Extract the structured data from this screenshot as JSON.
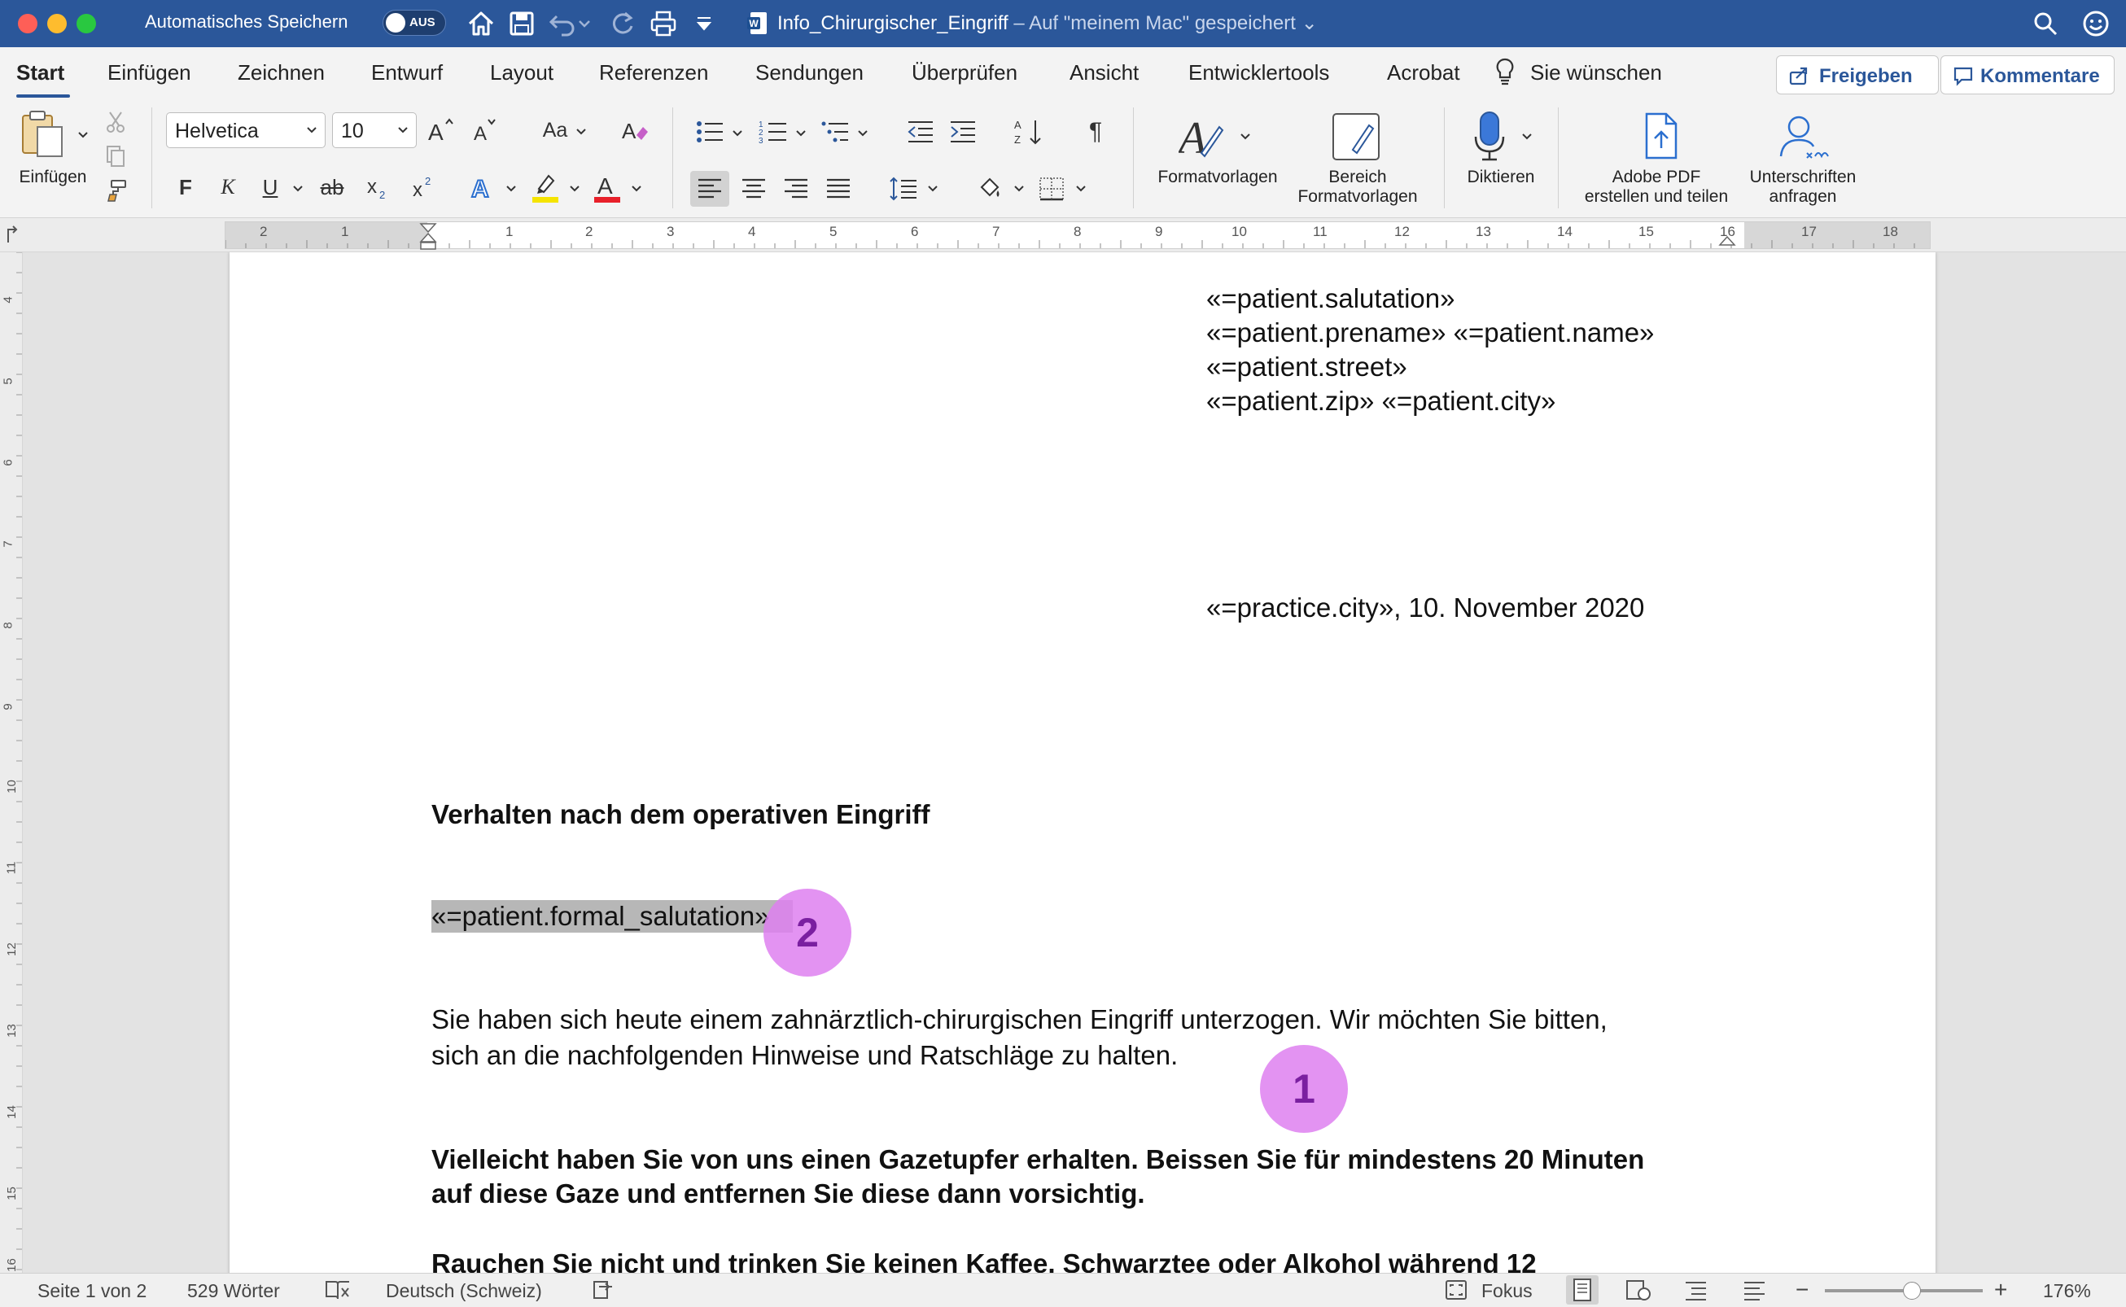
{
  "titlebar": {
    "autosave_label": "Automatisches Speichern",
    "autosave_state": "AUS",
    "doc_title": "Info_Chirurgischer_Eingriff",
    "doc_location": "– Auf \"meinem Mac\" gespeichert"
  },
  "tabs": [
    {
      "label": "Start",
      "active": true
    },
    {
      "label": "Einfügen"
    },
    {
      "label": "Zeichnen"
    },
    {
      "label": "Entwurf"
    },
    {
      "label": "Layout"
    },
    {
      "label": "Referenzen"
    },
    {
      "label": "Sendungen"
    },
    {
      "label": "Überprüfen"
    },
    {
      "label": "Ansicht"
    },
    {
      "label": "Entwicklertools"
    },
    {
      "label": "Acrobat"
    },
    {
      "label": "Sie wünschen"
    }
  ],
  "ribbon_actions": {
    "share": "Freigeben",
    "comments": "Kommentare"
  },
  "ribbon": {
    "paste_label": "Einfügen",
    "font_name": "Helvetica",
    "font_size": "10",
    "bold": "F",
    "italic": "K",
    "underline": "U",
    "strike": "ab",
    "change_case": "Aa",
    "styles_label": "Formatvorlagen",
    "styles_pane_line1": "Bereich",
    "styles_pane_line2": "Formatvorlagen",
    "dictate_label": "Diktieren",
    "adobe_line1": "Adobe PDF",
    "adobe_line2": "erstellen und teilen",
    "sign_line1": "Unterschriften",
    "sign_line2": "anfragen"
  },
  "ruler": {
    "numbers": [
      "2",
      "1",
      "1",
      "2",
      "3",
      "4",
      "5",
      "6",
      "7",
      "8",
      "9",
      "10",
      "11",
      "12",
      "13",
      "14",
      "15",
      "16",
      "17",
      "18"
    ],
    "vertical_numbers": [
      "4",
      "5",
      "6",
      "7",
      "8",
      "9",
      "10",
      "11",
      "12",
      "13",
      "14",
      "15",
      "16"
    ]
  },
  "document": {
    "address": [
      "«=patient.salutation»",
      "«=patient.prename» «=patient.name»",
      "«=patient.street»",
      "«=patient.zip» «=patient.city»"
    ],
    "date_line": "«=practice.city», 10. November 2020",
    "heading": "Verhalten nach dem operativen Eingriff",
    "formal_salutation": "«=patient.formal_salutation»",
    "paragraph1": [
      "Sie haben sich heute einem zahnärztlich-chirurgischen Eingriff unterzogen. Wir möchten Sie bitten,",
      "sich an die nachfolgenden Hinweise und Ratschläge zu halten."
    ],
    "paragraph2": [
      "Vielleicht haben Sie von uns einen Gazetupfer erhalten. Beissen Sie für mindestens 20 Minuten",
      "auf diese Gaze und entfernen Sie diese dann vorsichtig."
    ],
    "paragraph3": "Rauchen Sie nicht und trinken Sie keinen Kaffee, Schwarztee oder Alkohol während 12"
  },
  "markers": {
    "one": "1",
    "two": "2"
  },
  "statusbar": {
    "page": "Seite 1 von 2",
    "words": "529 Wörter",
    "language": "Deutsch (Schweiz)",
    "focus": "Fokus",
    "zoom": "176%",
    "zoom_level": 0.55
  },
  "colors": {
    "titlebar": "#2b579a",
    "marker": "#de80f0",
    "selection": "#b7b7b7"
  }
}
